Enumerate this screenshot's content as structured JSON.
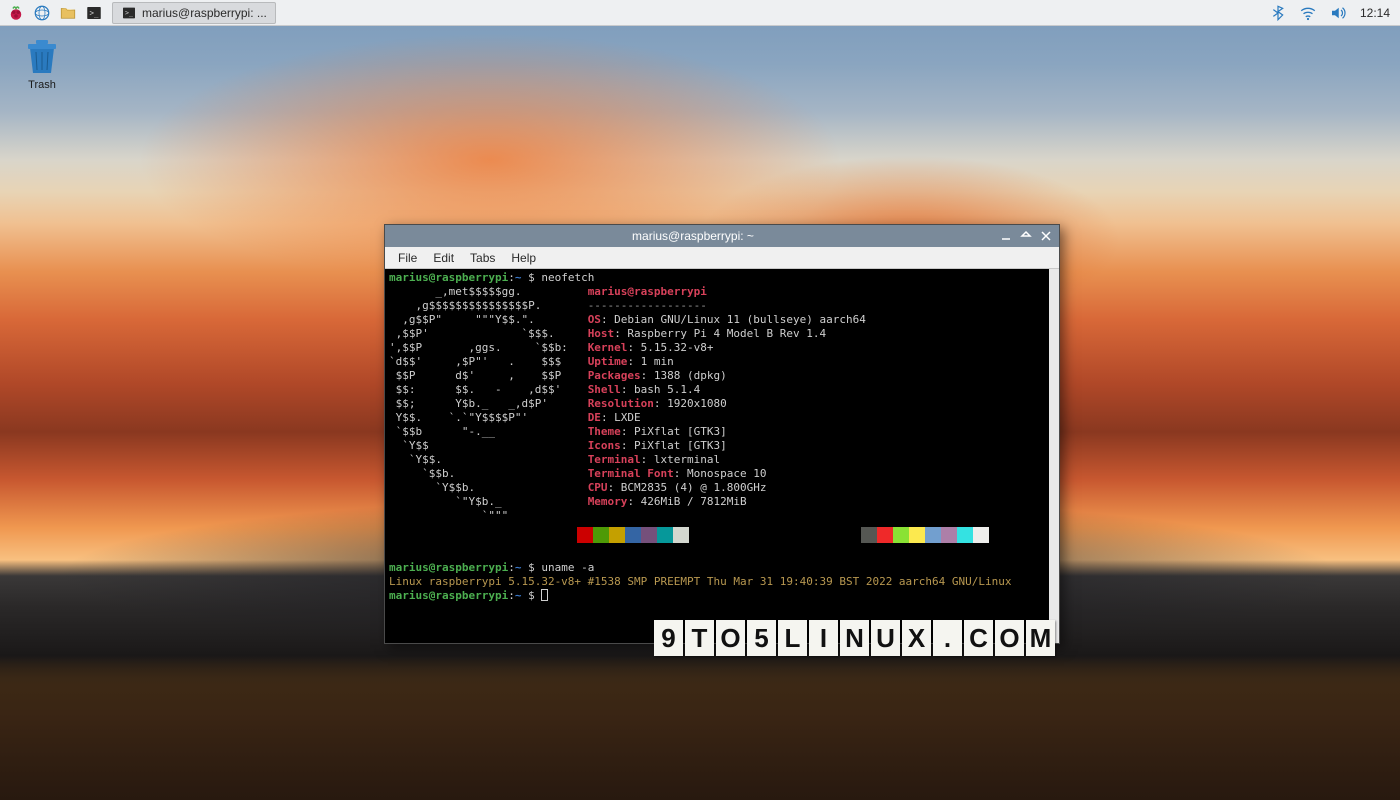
{
  "taskbar": {
    "app_button": "raspberry-menu",
    "launchers": [
      "web-browser-icon",
      "file-manager-icon",
      "terminal-icon"
    ],
    "task": {
      "label": "marius@raspberrypi: ...",
      "icon": "terminal-icon"
    },
    "tray": [
      "bluetooth-icon",
      "wifi-icon",
      "volume-icon"
    ],
    "clock": "12:14"
  },
  "desktop": {
    "trash_label": "Trash"
  },
  "terminal": {
    "title": "marius@raspberrypi: ~",
    "menu": {
      "file": "File",
      "edit": "Edit",
      "tabs": "Tabs",
      "help": "Help"
    },
    "window_controls": {
      "min": "minimize",
      "max": "maximize",
      "close": "close"
    },
    "prompt_user": "marius@raspberrypi",
    "prompt_path": "~",
    "prompt_sym": "$",
    "cmd1": "neofetch",
    "ascii": [
      "       _,met$$$$$gg.        ",
      "    ,g$$$$$$$$$$$$$$$P.     ",
      "  ,g$$P\"     \"\"\"Y$$.\".     ",
      " ,$$P'              `$$$.   ",
      "',$$P       ,ggs.     `$$b: ",
      "`d$$'     ,$P\"'   .    $$$  ",
      " $$P      d$'     ,    $$P  ",
      " $$:      $$.   -    ,d$$'  ",
      " $$;      Y$b._   _,d$P'    ",
      " Y$$.    `.`\"Y$$$$P\"'       ",
      " `$$b      \"-.__            ",
      "  `Y$$                       ",
      "   `Y$$.                     ",
      "     `$$b.                   ",
      "       `Y$$b.                ",
      "          `\"Y$b._            ",
      "              `\"\"\"           "
    ],
    "info_head": "marius@raspberrypi",
    "info_sep": "------------------",
    "info": [
      {
        "label": "OS",
        "value": "Debian GNU/Linux 11 (bullseye) aarch64"
      },
      {
        "label": "Host",
        "value": "Raspberry Pi 4 Model B Rev 1.4"
      },
      {
        "label": "Kernel",
        "value": "5.15.32-v8+"
      },
      {
        "label": "Uptime",
        "value": "1 min"
      },
      {
        "label": "Packages",
        "value": "1388 (dpkg)"
      },
      {
        "label": "Shell",
        "value": "bash 5.1.4"
      },
      {
        "label": "Resolution",
        "value": "1920x1080"
      },
      {
        "label": "DE",
        "value": "LXDE"
      },
      {
        "label": "Theme",
        "value": "PiXflat [GTK3]"
      },
      {
        "label": "Icons",
        "value": "PiXflat [GTK3]"
      },
      {
        "label": "Terminal",
        "value": "lxterminal"
      },
      {
        "label": "Terminal Font",
        "value": "Monospace 10"
      },
      {
        "label": "CPU",
        "value": "BCM2835 (4) @ 1.800GHz"
      },
      {
        "label": "Memory",
        "value": "426MiB / 7812MiB"
      }
    ],
    "swatch_colors": [
      "#000000",
      "#cc0000",
      "#4e9a06",
      "#c4a000",
      "#3465a4",
      "#75507b",
      "#06989a",
      "#d3d7cf",
      "#555753",
      "#ef2929",
      "#8ae234",
      "#fce94f",
      "#729fcf",
      "#ad7fa8",
      "#34e2e2",
      "#eeeeec"
    ],
    "cmd2": "uname -a",
    "uname_output": "Linux raspberrypi 5.15.32-v8+ #1538 SMP PREEMPT Thu Mar 31 19:40:39 BST 2022 aarch64 GNU/Linux"
  },
  "watermark": "9TO5LINUX.COM"
}
